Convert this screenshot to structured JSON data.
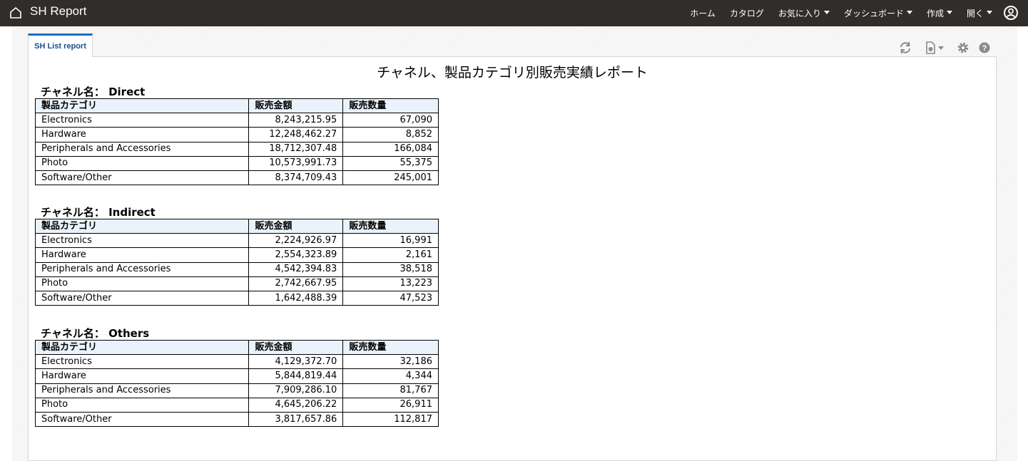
{
  "header": {
    "app_title": "SH Report",
    "nav": [
      {
        "label": "ホーム",
        "has_caret": false
      },
      {
        "label": "カタログ",
        "has_caret": false
      },
      {
        "label": "お気に入り",
        "has_caret": true
      },
      {
        "label": "ダッシュボード",
        "has_caret": true
      },
      {
        "label": "作成",
        "has_caret": true
      },
      {
        "label": "開く",
        "has_caret": true
      }
    ],
    "icons": {
      "home": "home-icon",
      "user": "user-circle-icon"
    }
  },
  "tabs": [
    {
      "label": "SH List report",
      "active": true
    }
  ],
  "toolbar_icons": [
    "refresh-icon",
    "export-icon",
    "settings-icon",
    "help-icon"
  ],
  "report": {
    "title": "チャネル、製品カテゴリ別販売実績レポート",
    "columns": [
      "製品カテゴリ",
      "販売金額",
      "販売数量"
    ],
    "sections": [
      {
        "heading": "チャネル名： Direct",
        "rows": [
          [
            "Electronics",
            "8,243,215.95",
            "67,090"
          ],
          [
            "Hardware",
            "12,248,462.27",
            "8,852"
          ],
          [
            "Peripherals and Accessories",
            "18,712,307.48",
            "166,084"
          ],
          [
            "Photo",
            "10,573,991.73",
            "55,375"
          ],
          [
            "Software/Other",
            "8,374,709.43",
            "245,001"
          ]
        ]
      },
      {
        "heading": "チャネル名： Indirect",
        "rows": [
          [
            "Electronics",
            "2,224,926.97",
            "16,991"
          ],
          [
            "Hardware",
            "2,554,323.89",
            "2,161"
          ],
          [
            "Peripherals and Accessories",
            "4,542,394.83",
            "38,518"
          ],
          [
            "Photo",
            "2,742,667.95",
            "13,223"
          ],
          [
            "Software/Other",
            "1,642,488.39",
            "47,523"
          ]
        ]
      },
      {
        "heading": "チャネル名： Others",
        "rows": [
          [
            "Electronics",
            "4,129,372.70",
            "32,186"
          ],
          [
            "Hardware",
            "5,844,819.44",
            "4,344"
          ],
          [
            "Peripherals and Accessories",
            "7,909,286.10",
            "81,767"
          ],
          [
            "Photo",
            "4,645,206.22",
            "26,911"
          ],
          [
            "Software/Other",
            "3,817,657.86",
            "112,817"
          ]
        ]
      }
    ]
  },
  "colors": {
    "topbar": "#312d2a",
    "tab_accent": "#1b6ec2",
    "table_header_bg": "#eaf3fb"
  }
}
